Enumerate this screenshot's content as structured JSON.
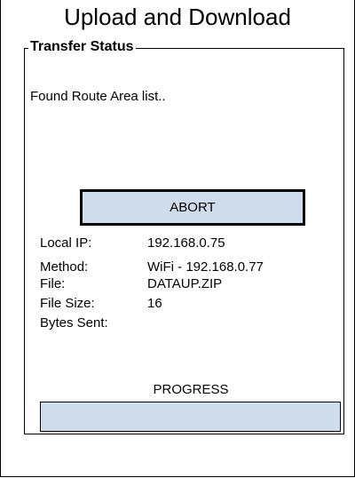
{
  "title": "Upload and Download",
  "transfer_status": {
    "group_title": "Transfer Status",
    "message": "Found Route Area list..",
    "abort_label": "ABORT",
    "fields": {
      "local_ip": {
        "label": "Local IP:",
        "value": "192.168.0.75"
      },
      "method": {
        "label": "Method:",
        "value": "WiFi - 192.168.0.77"
      },
      "file": {
        "label": "File:",
        "value": "DATAUP.ZIP"
      },
      "file_size": {
        "label": "File Size:",
        "value": "16"
      },
      "bytes_sent": {
        "label": "Bytes Sent:",
        "value": ""
      }
    },
    "progress_label": "PROGRESS",
    "progress_fraction": 0
  },
  "colors": {
    "button_fill": "#cfdceb",
    "progress_fill": "#4a6fa5"
  }
}
